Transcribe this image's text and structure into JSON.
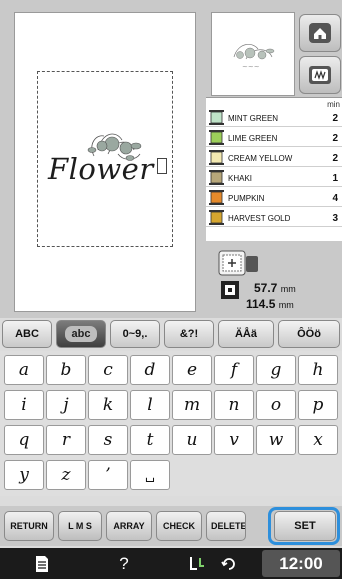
{
  "design": {
    "text": "Flower"
  },
  "thread_list": {
    "min_label": "min",
    "items": [
      {
        "color_name": "MINT GREEN",
        "minutes": "2",
        "swatch": "#bfe3c8"
      },
      {
        "color_name": "LIME GREEN",
        "minutes": "2",
        "swatch": "#9ccf5a"
      },
      {
        "color_name": "CREAM YELLOW",
        "minutes": "2",
        "swatch": "#f3e9b1"
      },
      {
        "color_name": "KHAKI",
        "minutes": "1",
        "swatch": "#b7a77a"
      },
      {
        "color_name": "PUMPKIN",
        "minutes": "4",
        "swatch": "#e58a2b"
      },
      {
        "color_name": "HARVEST GOLD",
        "minutes": "3",
        "swatch": "#d6a62f"
      }
    ]
  },
  "size": {
    "height_value": "57.7",
    "width_value": "114.5",
    "unit": "mm"
  },
  "char_tabs": [
    "ABC",
    "abc",
    "0~9,.",
    "&?!",
    "ÄÅä",
    "ÔÖö"
  ],
  "active_tab": "abc",
  "keys": [
    [
      "a",
      "b",
      "c",
      "d",
      "e",
      "f",
      "g",
      "h"
    ],
    [
      "i",
      "j",
      "k",
      "l",
      "m",
      "n",
      "o",
      "p"
    ],
    [
      "q",
      "r",
      "s",
      "t",
      "u",
      "v",
      "w",
      "x"
    ],
    [
      "y",
      "z",
      "’",
      "␣"
    ]
  ],
  "function_bar": {
    "return_label": "RETURN",
    "size_label": "L M S",
    "array_label": "ARRAY",
    "check_label": "CHECK",
    "delete_label": "DELETE",
    "set_label": "SET"
  },
  "status": {
    "time": "12:00",
    "help_label": "?"
  },
  "icons": {
    "home": "home-icon",
    "frame_select": "frame-select-icon",
    "hoop": "hoop-icon",
    "size": "size-icon",
    "notes": "notes-icon",
    "thread_cut": "thread-cut-icon",
    "rotate": "rotate-icon"
  },
  "colors": {
    "highlight": "#2d8fdc",
    "active_tab": "#4a4a4a",
    "status_bar": "#1b1b1b"
  }
}
